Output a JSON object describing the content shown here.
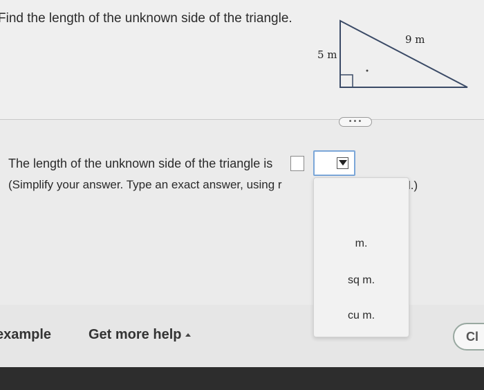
{
  "question": {
    "prompt": "Find the length of the unknown side of the triangle.",
    "figure": {
      "side_vertical": "5 m",
      "hypotenuse": "9 m"
    }
  },
  "more_button_label": "•••",
  "answer": {
    "sentence": "The length of the unknown side of the triangle is",
    "value": "",
    "unit_selected": "",
    "hint_visible": "(Simplify your answer. Type an exact answer, using r",
    "hint_tail": "l.)"
  },
  "unit_dropdown": {
    "options": [
      "m.",
      "sq m.",
      "cu m."
    ]
  },
  "footer": {
    "example_label": "example",
    "help_label": "Get more help",
    "check_label": "Cl"
  }
}
